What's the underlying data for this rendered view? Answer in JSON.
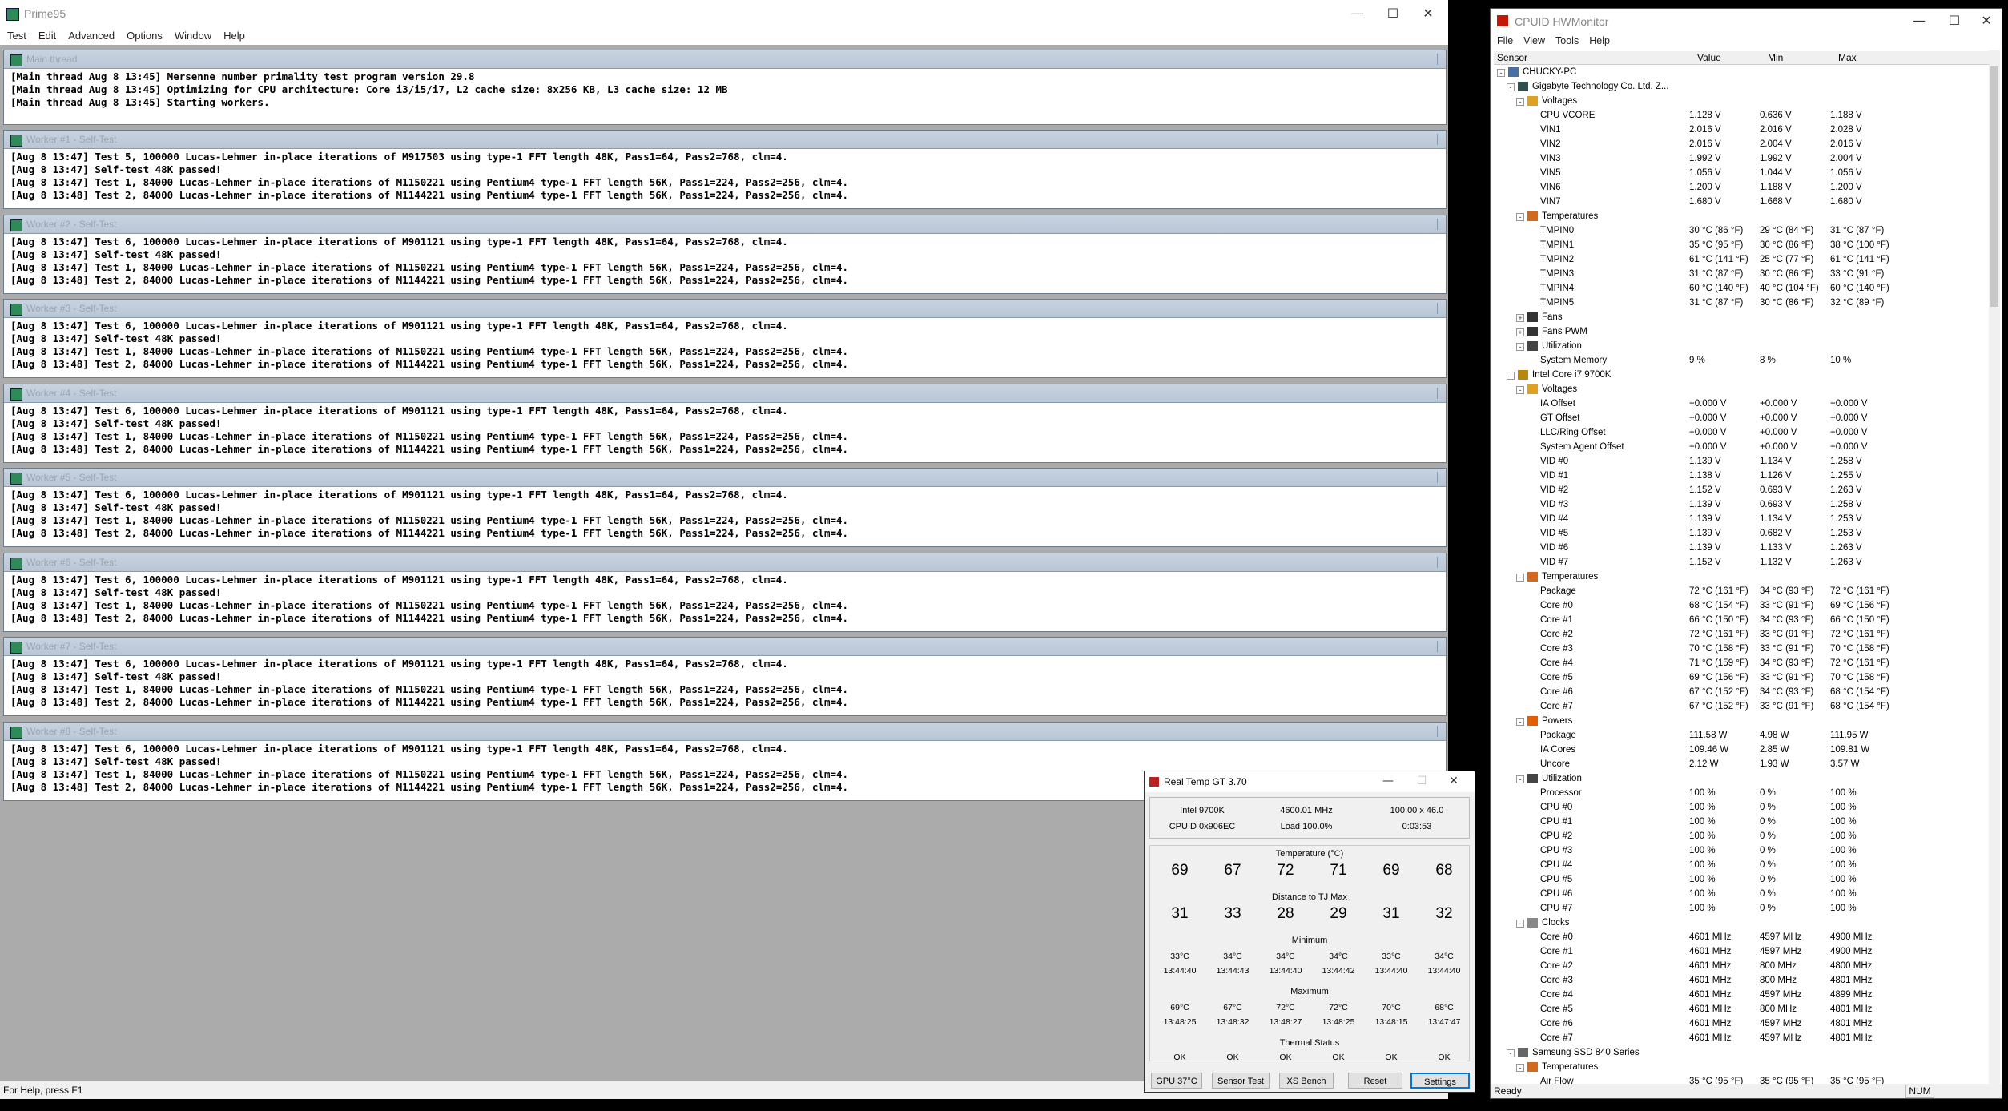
{
  "prime": {
    "title": "Prime95",
    "menu": [
      "Test",
      "Edit",
      "Advanced",
      "Options",
      "Window",
      "Help"
    ],
    "main": {
      "title": "Main thread",
      "lines": [
        "[Main thread Aug 8 13:45] Mersenne number primality test program version 29.8",
        "[Main thread Aug 8 13:45] Optimizing for CPU architecture: Core i3/i5/i7, L2 cache size: 8x256 KB, L3 cache size: 12 MB",
        "[Main thread Aug 8 13:45] Starting workers."
      ]
    },
    "workers": [
      {
        "title": "Worker #1 - Self-Test",
        "lines": [
          "[Aug 8 13:47] Test 5, 100000 Lucas-Lehmer in-place iterations of M917503 using type-1 FFT length 48K, Pass1=64, Pass2=768, clm=4.",
          "[Aug 8 13:47] Self-test 48K passed!",
          "[Aug 8 13:47] Test 1, 84000 Lucas-Lehmer in-place iterations of M1150221 using Pentium4 type-1 FFT length 56K, Pass1=224, Pass2=256, clm=4.",
          "[Aug 8 13:48] Test 2, 84000 Lucas-Lehmer in-place iterations of M1144221 using Pentium4 type-1 FFT length 56K, Pass1=224, Pass2=256, clm=4."
        ]
      },
      {
        "title": "Worker #2 - Self-Test",
        "lines": [
          "[Aug 8 13:47] Test 6, 100000 Lucas-Lehmer in-place iterations of M901121 using type-1 FFT length 48K, Pass1=64, Pass2=768, clm=4.",
          "[Aug 8 13:47] Self-test 48K passed!",
          "[Aug 8 13:47] Test 1, 84000 Lucas-Lehmer in-place iterations of M1150221 using Pentium4 type-1 FFT length 56K, Pass1=224, Pass2=256, clm=4.",
          "[Aug 8 13:48] Test 2, 84000 Lucas-Lehmer in-place iterations of M1144221 using Pentium4 type-1 FFT length 56K, Pass1=224, Pass2=256, clm=4."
        ]
      },
      {
        "title": "Worker #3 - Self-Test",
        "lines": [
          "[Aug 8 13:47] Test 6, 100000 Lucas-Lehmer in-place iterations of M901121 using type-1 FFT length 48K, Pass1=64, Pass2=768, clm=4.",
          "[Aug 8 13:47] Self-test 48K passed!",
          "[Aug 8 13:47] Test 1, 84000 Lucas-Lehmer in-place iterations of M1150221 using Pentium4 type-1 FFT length 56K, Pass1=224, Pass2=256, clm=4.",
          "[Aug 8 13:48] Test 2, 84000 Lucas-Lehmer in-place iterations of M1144221 using Pentium4 type-1 FFT length 56K, Pass1=224, Pass2=256, clm=4."
        ]
      },
      {
        "title": "Worker #4 - Self-Test",
        "lines": [
          "[Aug 8 13:47] Test 6, 100000 Lucas-Lehmer in-place iterations of M901121 using type-1 FFT length 48K, Pass1=64, Pass2=768, clm=4.",
          "[Aug 8 13:47] Self-test 48K passed!",
          "[Aug 8 13:47] Test 1, 84000 Lucas-Lehmer in-place iterations of M1150221 using Pentium4 type-1 FFT length 56K, Pass1=224, Pass2=256, clm=4.",
          "[Aug 8 13:48] Test 2, 84000 Lucas-Lehmer in-place iterations of M1144221 using Pentium4 type-1 FFT length 56K, Pass1=224, Pass2=256, clm=4."
        ]
      },
      {
        "title": "Worker #5 - Self-Test",
        "lines": [
          "[Aug 8 13:47] Test 6, 100000 Lucas-Lehmer in-place iterations of M901121 using type-1 FFT length 48K, Pass1=64, Pass2=768, clm=4.",
          "[Aug 8 13:47] Self-test 48K passed!",
          "[Aug 8 13:47] Test 1, 84000 Lucas-Lehmer in-place iterations of M1150221 using Pentium4 type-1 FFT length 56K, Pass1=224, Pass2=256, clm=4.",
          "[Aug 8 13:48] Test 2, 84000 Lucas-Lehmer in-place iterations of M1144221 using Pentium4 type-1 FFT length 56K, Pass1=224, Pass2=256, clm=4."
        ]
      },
      {
        "title": "Worker #6 - Self-Test",
        "lines": [
          "[Aug 8 13:47] Test 6, 100000 Lucas-Lehmer in-place iterations of M901121 using type-1 FFT length 48K, Pass1=64, Pass2=768, clm=4.",
          "[Aug 8 13:47] Self-test 48K passed!",
          "[Aug 8 13:47] Test 1, 84000 Lucas-Lehmer in-place iterations of M1150221 using Pentium4 type-1 FFT length 56K, Pass1=224, Pass2=256, clm=4.",
          "[Aug 8 13:48] Test 2, 84000 Lucas-Lehmer in-place iterations of M1144221 using Pentium4 type-1 FFT length 56K, Pass1=224, Pass2=256, clm=4."
        ]
      },
      {
        "title": "Worker #7 - Self-Test",
        "lines": [
          "[Aug 8 13:47] Test 6, 100000 Lucas-Lehmer in-place iterations of M901121 using type-1 FFT length 48K, Pass1=64, Pass2=768, clm=4.",
          "[Aug 8 13:47] Self-test 48K passed!",
          "[Aug 8 13:47] Test 1, 84000 Lucas-Lehmer in-place iterations of M1150221 using Pentium4 type-1 FFT length 56K, Pass1=224, Pass2=256, clm=4.",
          "[Aug 8 13:48] Test 2, 84000 Lucas-Lehmer in-place iterations of M1144221 using Pentium4 type-1 FFT length 56K, Pass1=224, Pass2=256, clm=4."
        ]
      },
      {
        "title": "Worker #8 - Self-Test",
        "lines": [
          "[Aug 8 13:47] Test 6, 100000 Lucas-Lehmer in-place iterations of M901121 using type-1 FFT length 48K, Pass1=64, Pass2=768, clm=4.",
          "[Aug 8 13:47] Self-test 48K passed!",
          "[Aug 8 13:47] Test 1, 84000 Lucas-Lehmer in-place iterations of M1150221 using Pentium4 type-1 FFT length 56K, Pass1=224, Pass2=256, clm=4.",
          "[Aug 8 13:48] Test 2, 84000 Lucas-Lehmer in-place iterations of M1144221 using Pentium4 type-1 FFT length 56K, Pass1=224, Pass2=256, clm=4."
        ]
      }
    ],
    "status": "For Help, press F1"
  },
  "hwmon": {
    "title": "CPUID HWMonitor",
    "menu": [
      "File",
      "View",
      "Tools",
      "Help"
    ],
    "columns": {
      "sensor": "Sensor",
      "value": "Value",
      "min": "Min",
      "max": "Max"
    },
    "rows": [
      {
        "lvl": 0,
        "exp": "-",
        "icon": "computer-icon",
        "label": "CHUCKY-PC"
      },
      {
        "lvl": 1,
        "exp": "-",
        "icon": "motherboard-icon",
        "label": "Gigabyte Technology Co. Ltd. Z..."
      },
      {
        "lvl": 2,
        "exp": "-",
        "icon": "voltage-icon",
        "label": "Voltages"
      },
      {
        "lvl": 3,
        "label": "CPU VCORE",
        "v": "1.128 V",
        "mn": "0.636 V",
        "mx": "1.188 V"
      },
      {
        "lvl": 3,
        "label": "VIN1",
        "v": "2.016 V",
        "mn": "2.016 V",
        "mx": "2.028 V"
      },
      {
        "lvl": 3,
        "label": "VIN2",
        "v": "2.016 V",
        "mn": "2.004 V",
        "mx": "2.016 V"
      },
      {
        "lvl": 3,
        "label": "VIN3",
        "v": "1.992 V",
        "mn": "1.992 V",
        "mx": "2.004 V"
      },
      {
        "lvl": 3,
        "label": "VIN5",
        "v": "1.056 V",
        "mn": "1.044 V",
        "mx": "1.056 V"
      },
      {
        "lvl": 3,
        "label": "VIN6",
        "v": "1.200 V",
        "mn": "1.188 V",
        "mx": "1.200 V"
      },
      {
        "lvl": 3,
        "label": "VIN7",
        "v": "1.680 V",
        "mn": "1.668 V",
        "mx": "1.680 V"
      },
      {
        "lvl": 2,
        "exp": "-",
        "icon": "temperature-icon",
        "label": "Temperatures"
      },
      {
        "lvl": 3,
        "label": "TMPIN0",
        "v": "30 °C  (86 °F)",
        "mn": "29 °C  (84 °F)",
        "mx": "31 °C  (87 °F)"
      },
      {
        "lvl": 3,
        "label": "TMPIN1",
        "v": "35 °C  (95 °F)",
        "mn": "30 °C  (86 °F)",
        "mx": "38 °C  (100 °F)"
      },
      {
        "lvl": 3,
        "label": "TMPIN2",
        "v": "61 °C  (141 °F)",
        "mn": "25 °C  (77 °F)",
        "mx": "61 °C  (141 °F)"
      },
      {
        "lvl": 3,
        "label": "TMPIN3",
        "v": "31 °C  (87 °F)",
        "mn": "30 °C  (86 °F)",
        "mx": "33 °C  (91 °F)"
      },
      {
        "lvl": 3,
        "label": "TMPIN4",
        "v": "60 °C  (140 °F)",
        "mn": "40 °C  (104 °F)",
        "mx": "60 °C  (140 °F)"
      },
      {
        "lvl": 3,
        "label": "TMPIN5",
        "v": "31 °C  (87 °F)",
        "mn": "30 °C  (86 °F)",
        "mx": "32 °C  (89 °F)"
      },
      {
        "lvl": 2,
        "exp": "+",
        "icon": "fan-icon",
        "label": "Fans"
      },
      {
        "lvl": 2,
        "exp": "+",
        "icon": "fan-icon",
        "label": "Fans PWM"
      },
      {
        "lvl": 2,
        "exp": "-",
        "icon": "utilization-icon",
        "label": "Utilization"
      },
      {
        "lvl": 3,
        "label": "System Memory",
        "v": "9 %",
        "mn": "8 %",
        "mx": "10 %"
      },
      {
        "lvl": 1,
        "exp": "-",
        "icon": "cpu-icon",
        "label": "Intel Core i7 9700K"
      },
      {
        "lvl": 2,
        "exp": "-",
        "icon": "voltage-icon",
        "label": "Voltages"
      },
      {
        "lvl": 3,
        "label": "IA Offset",
        "v": "+0.000 V",
        "mn": "+0.000 V",
        "mx": "+0.000 V"
      },
      {
        "lvl": 3,
        "label": "GT Offset",
        "v": "+0.000 V",
        "mn": "+0.000 V",
        "mx": "+0.000 V"
      },
      {
        "lvl": 3,
        "label": "LLC/Ring Offset",
        "v": "+0.000 V",
        "mn": "+0.000 V",
        "mx": "+0.000 V"
      },
      {
        "lvl": 3,
        "label": "System Agent Offset",
        "v": "+0.000 V",
        "mn": "+0.000 V",
        "mx": "+0.000 V"
      },
      {
        "lvl": 3,
        "label": "VID #0",
        "v": "1.139 V",
        "mn": "1.134 V",
        "mx": "1.258 V"
      },
      {
        "lvl": 3,
        "label": "VID #1",
        "v": "1.138 V",
        "mn": "1.126 V",
        "mx": "1.255 V"
      },
      {
        "lvl": 3,
        "label": "VID #2",
        "v": "1.152 V",
        "mn": "0.693 V",
        "mx": "1.263 V"
      },
      {
        "lvl": 3,
        "label": "VID #3",
        "v": "1.139 V",
        "mn": "0.693 V",
        "mx": "1.258 V"
      },
      {
        "lvl": 3,
        "label": "VID #4",
        "v": "1.139 V",
        "mn": "1.134 V",
        "mx": "1.253 V"
      },
      {
        "lvl": 3,
        "label": "VID #5",
        "v": "1.139 V",
        "mn": "0.682 V",
        "mx": "1.253 V"
      },
      {
        "lvl": 3,
        "label": "VID #6",
        "v": "1.139 V",
        "mn": "1.133 V",
        "mx": "1.263 V"
      },
      {
        "lvl": 3,
        "label": "VID #7",
        "v": "1.152 V",
        "mn": "1.132 V",
        "mx": "1.263 V"
      },
      {
        "lvl": 2,
        "exp": "-",
        "icon": "temperature-icon",
        "label": "Temperatures"
      },
      {
        "lvl": 3,
        "label": "Package",
        "v": "72 °C  (161 °F)",
        "mn": "34 °C  (93 °F)",
        "mx": "72 °C  (161 °F)"
      },
      {
        "lvl": 3,
        "label": "Core #0",
        "v": "68 °C  (154 °F)",
        "mn": "33 °C  (91 °F)",
        "mx": "69 °C  (156 °F)"
      },
      {
        "lvl": 3,
        "label": "Core #1",
        "v": "66 °C  (150 °F)",
        "mn": "34 °C  (93 °F)",
        "mx": "66 °C  (150 °F)"
      },
      {
        "lvl": 3,
        "label": "Core #2",
        "v": "72 °C  (161 °F)",
        "mn": "33 °C  (91 °F)",
        "mx": "72 °C  (161 °F)"
      },
      {
        "lvl": 3,
        "label": "Core #3",
        "v": "70 °C  (158 °F)",
        "mn": "33 °C  (91 °F)",
        "mx": "70 °C  (158 °F)"
      },
      {
        "lvl": 3,
        "label": "Core #4",
        "v": "71 °C  (159 °F)",
        "mn": "34 °C  (93 °F)",
        "mx": "72 °C  (161 °F)"
      },
      {
        "lvl": 3,
        "label": "Core #5",
        "v": "69 °C  (156 °F)",
        "mn": "33 °C  (91 °F)",
        "mx": "70 °C  (158 °F)"
      },
      {
        "lvl": 3,
        "label": "Core #6",
        "v": "67 °C  (152 °F)",
        "mn": "34 °C  (93 °F)",
        "mx": "68 °C  (154 °F)"
      },
      {
        "lvl": 3,
        "label": "Core #7",
        "v": "67 °C  (152 °F)",
        "mn": "33 °C  (91 °F)",
        "mx": "68 °C  (154 °F)"
      },
      {
        "lvl": 2,
        "exp": "-",
        "icon": "power-icon",
        "label": "Powers"
      },
      {
        "lvl": 3,
        "label": "Package",
        "v": "111.58 W",
        "mn": "4.98 W",
        "mx": "111.95 W"
      },
      {
        "lvl": 3,
        "label": "IA Cores",
        "v": "109.46 W",
        "mn": "2.85 W",
        "mx": "109.81 W"
      },
      {
        "lvl": 3,
        "label": "Uncore",
        "v": "2.12 W",
        "mn": "1.93 W",
        "mx": "3.57 W"
      },
      {
        "lvl": 2,
        "exp": "-",
        "icon": "utilization-icon",
        "label": "Utilization"
      },
      {
        "lvl": 3,
        "label": "Processor",
        "v": "100 %",
        "mn": "0 %",
        "mx": "100 %"
      },
      {
        "lvl": 3,
        "label": "CPU #0",
        "v": "100 %",
        "mn": "0 %",
        "mx": "100 %"
      },
      {
        "lvl": 3,
        "label": "CPU #1",
        "v": "100 %",
        "mn": "0 %",
        "mx": "100 %"
      },
      {
        "lvl": 3,
        "label": "CPU #2",
        "v": "100 %",
        "mn": "0 %",
        "mx": "100 %"
      },
      {
        "lvl": 3,
        "label": "CPU #3",
        "v": "100 %",
        "mn": "0 %",
        "mx": "100 %"
      },
      {
        "lvl": 3,
        "label": "CPU #4",
        "v": "100 %",
        "mn": "0 %",
        "mx": "100 %"
      },
      {
        "lvl": 3,
        "label": "CPU #5",
        "v": "100 %",
        "mn": "0 %",
        "mx": "100 %"
      },
      {
        "lvl": 3,
        "label": "CPU #6",
        "v": "100 %",
        "mn": "0 %",
        "mx": "100 %"
      },
      {
        "lvl": 3,
        "label": "CPU #7",
        "v": "100 %",
        "mn": "0 %",
        "mx": "100 %"
      },
      {
        "lvl": 2,
        "exp": "-",
        "icon": "clock-icon",
        "label": "Clocks"
      },
      {
        "lvl": 3,
        "label": "Core #0",
        "v": "4601 MHz",
        "mn": "4597 MHz",
        "mx": "4900 MHz"
      },
      {
        "lvl": 3,
        "label": "Core #1",
        "v": "4601 MHz",
        "mn": "4597 MHz",
        "mx": "4900 MHz"
      },
      {
        "lvl": 3,
        "label": "Core #2",
        "v": "4601 MHz",
        "mn": "800 MHz",
        "mx": "4800 MHz"
      },
      {
        "lvl": 3,
        "label": "Core #3",
        "v": "4601 MHz",
        "mn": "800 MHz",
        "mx": "4801 MHz"
      },
      {
        "lvl": 3,
        "label": "Core #4",
        "v": "4601 MHz",
        "mn": "4597 MHz",
        "mx": "4899 MHz"
      },
      {
        "lvl": 3,
        "label": "Core #5",
        "v": "4601 MHz",
        "mn": "800 MHz",
        "mx": "4801 MHz"
      },
      {
        "lvl": 3,
        "label": "Core #6",
        "v": "4601 MHz",
        "mn": "4597 MHz",
        "mx": "4801 MHz"
      },
      {
        "lvl": 3,
        "label": "Core #7",
        "v": "4601 MHz",
        "mn": "4597 MHz",
        "mx": "4801 MHz"
      },
      {
        "lvl": 1,
        "exp": "-",
        "icon": "ssd-icon",
        "label": "Samsung SSD 840 Series"
      },
      {
        "lvl": 2,
        "exp": "-",
        "icon": "temperature-icon",
        "label": "Temperatures"
      },
      {
        "lvl": 3,
        "label": "Air Flow",
        "v": "35 °C  (95 °F)",
        "mn": "35 °C  (95 °F)",
        "mx": "35 °C  (95 °F)"
      }
    ],
    "status": "Ready",
    "num": "NUM"
  },
  "realtemp": {
    "title": "Real Temp GT 3.70",
    "cpu": "Intel 9700K",
    "freq": "4600.01 MHz",
    "mult": "100.00 x 46.0",
    "cpuid": "CPUID  0x906EC",
    "load": "Load 100.0%",
    "time": "0:03:53",
    "temp_label": "Temperature (°C)",
    "temps": [
      "69",
      "67",
      "72",
      "71",
      "69",
      "68"
    ],
    "dist_label": "Distance to TJ Max",
    "dist": [
      "31",
      "33",
      "28",
      "29",
      "31",
      "32"
    ],
    "min_label": "Minimum",
    "min_vals": [
      "33°C",
      "34°C",
      "34°C",
      "34°C",
      "33°C",
      "34°C"
    ],
    "min_times": [
      "13:44:40",
      "13:44:43",
      "13:44:40",
      "13:44:42",
      "13:44:40",
      "13:44:40"
    ],
    "max_label": "Maximum",
    "max_vals": [
      "69°C",
      "67°C",
      "72°C",
      "72°C",
      "70°C",
      "68°C"
    ],
    "max_times": [
      "13:48:25",
      "13:48:32",
      "13:48:27",
      "13:48:25",
      "13:48:15",
      "13:47:47"
    ],
    "thermal_label": "Thermal Status",
    "thermal": [
      "OK",
      "OK",
      "OK",
      "OK",
      "OK",
      "OK"
    ],
    "buttons": {
      "gpu": "GPU  37°C",
      "sensor": "Sensor Test",
      "xs": "XS Bench",
      "reset": "Reset",
      "settings": "Settings"
    }
  }
}
